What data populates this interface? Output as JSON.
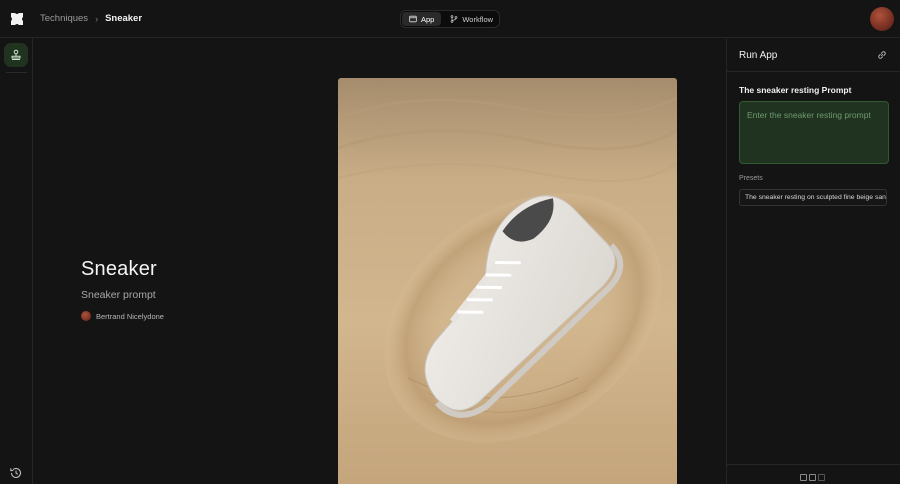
{
  "header": {
    "breadcrumb": {
      "parent": "Techniques",
      "separator": "›",
      "current": "Sneaker"
    },
    "mode_toggle": [
      {
        "label": "App",
        "icon": "window-icon",
        "active": true
      },
      {
        "label": "Workflow",
        "icon": "branch-icon",
        "active": false
      }
    ]
  },
  "main": {
    "title": "Sneaker",
    "subtitle": "Sneaker prompt",
    "author": "Bertrand Nicelydone"
  },
  "panel": {
    "title": "Run App",
    "prompt_label": "The sneaker resting Prompt",
    "prompt_placeholder": "Enter the sneaker resting prompt",
    "presets_label": "Presets",
    "presets": [
      "The sneaker resting on sculpted fine beige sand"
    ]
  },
  "colors": {
    "accent_green_bg": "#1f3320",
    "accent_green_border": "#2f5a30",
    "background": "#141414"
  }
}
